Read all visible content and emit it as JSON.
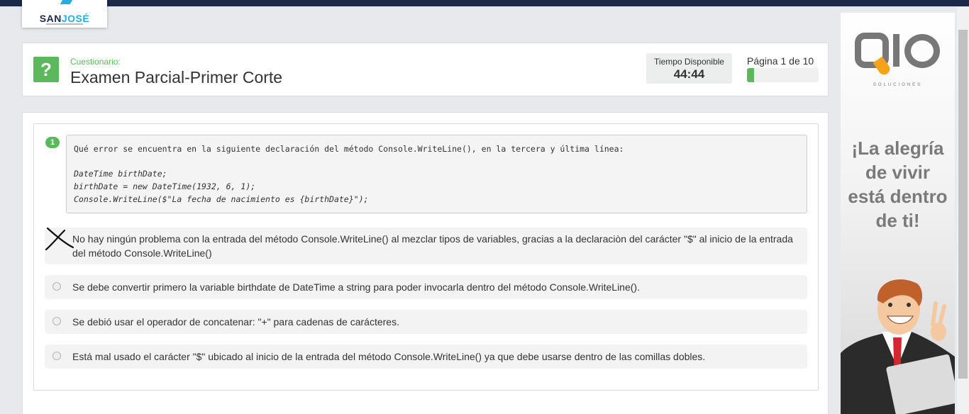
{
  "header": {
    "logo_text_a": "SAN",
    "logo_text_b": "JOSÉ",
    "quiz_label": "Cuestionario:",
    "quiz_title": "Examen Parcial-Primer Corte",
    "timer_label": "Tiempo Disponible",
    "timer_value": "44:44",
    "page_label": "Página 1 de 10",
    "progress_fraction": 0.1
  },
  "question": {
    "number": "1",
    "code_lines": [
      "Qué error se encuentra en la siguiente declaración del método Console.WriteLine(), en la tercera y última línea:",
      "DateTime birthDate;",
      "birthDate = new DateTime(1932, 6, 1);",
      "Console.WriteLine($\"La fecha de nacimiento es {birthDate}\");"
    ],
    "options": [
      {
        "text": "No hay ningún problema con la entrada del método Console.WriteLine() al mezclar tipos de variables, gracias a la declaraciòn del carácter \"$\" al inicio de la entrada",
        "text_cont": "del método Console.WriteLine()",
        "marked_x": true
      },
      {
        "text": "Se debe convertir primero la variable birthdate de DateTime a string para poder invocarla dentro del método Console.WriteLine().",
        "marked_x": false
      },
      {
        "text": "Se debió usar el operador de concatenar: \"+\" para cadenas de carácteres.",
        "marked_x": false
      },
      {
        "text": "Está mal usado el carácter \"$\" ubicado al inicio de la entrada del método Console.WriteLine() ya que debe usarse dentro de las comillas dobles.",
        "marked_x": false
      }
    ]
  },
  "ad": {
    "brand_sub": "SOLUCIONES",
    "slogan_lines": [
      "¡La alegría",
      "de vivir",
      "está dentro",
      "de ti!"
    ]
  },
  "colors": {
    "accent_green": "#5cb85c",
    "topbar": "#1b2a4a",
    "brand_blue": "#29abe2",
    "ad_orange": "#f6a21a"
  },
  "icons": {
    "question_icon": "question-mark-icon",
    "x_mark": "hand-drawn-x-icon",
    "radio": "radio-circle-icon"
  }
}
